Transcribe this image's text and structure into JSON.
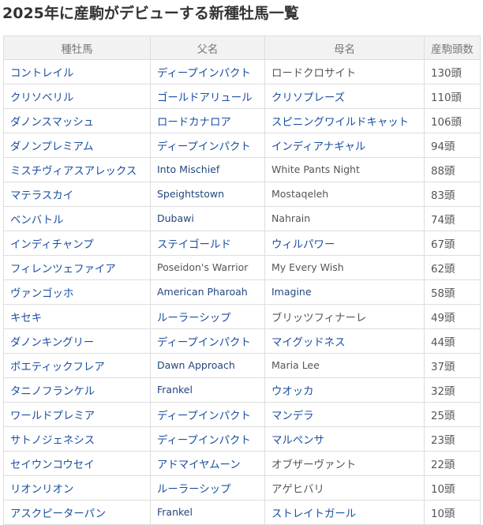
{
  "title": "2025年に産駒がデビューする新種牡馬一覧",
  "table": {
    "headers": [
      "種牡馬",
      "父名",
      "母名",
      "産駒頭数"
    ],
    "rows": [
      {
        "horse": "コントレイル",
        "sire": "ディープインパクト",
        "dam": "ロードクロサイト",
        "count": "130頭",
        "sire_link": true,
        "dam_link": false
      },
      {
        "horse": "クリソベリル",
        "sire": "ゴールドアリュール",
        "dam": "クリソプレーズ",
        "count": "110頭",
        "sire_link": true,
        "dam_link": true
      },
      {
        "horse": "ダノンスマッシュ",
        "sire": "ロードカナロア",
        "dam": "スピニングワイルドキャット",
        "count": "106頭",
        "sire_link": true,
        "dam_link": true
      },
      {
        "horse": "ダノンプレミアム",
        "sire": "ディープインパクト",
        "dam": "インディアナギャル",
        "count": "94頭",
        "sire_link": true,
        "dam_link": true
      },
      {
        "horse": "ミスチヴィアスアレックス",
        "sire": "Into Mischief",
        "dam": "White Pants Night",
        "count": "88頭",
        "sire_link": true,
        "dam_link": false
      },
      {
        "horse": "マテラスカイ",
        "sire": "Speightstown",
        "dam": "Mostaqeleh",
        "count": "83頭",
        "sire_link": true,
        "dam_link": false
      },
      {
        "horse": "ベンバトル",
        "sire": "Dubawi",
        "dam": "Nahrain",
        "count": "74頭",
        "sire_link": true,
        "dam_link": false
      },
      {
        "horse": "インディチャンプ",
        "sire": "ステイゴールド",
        "dam": "ウィルパワー",
        "count": "67頭",
        "sire_link": true,
        "dam_link": true
      },
      {
        "horse": "フィレンツェファイア",
        "sire": "Poseidon's Warrior",
        "dam": "My Every Wish",
        "count": "62頭",
        "sire_link": false,
        "dam_link": false
      },
      {
        "horse": "ヴァンゴッホ",
        "sire": "American Pharoah",
        "dam": "Imagine",
        "count": "58頭",
        "sire_link": true,
        "dam_link": true
      },
      {
        "horse": "キセキ",
        "sire": "ルーラーシップ",
        "dam": "ブリッツフィナーレ",
        "count": "49頭",
        "sire_link": true,
        "dam_link": false
      },
      {
        "horse": "ダノンキングリー",
        "sire": "ディープインパクト",
        "dam": "マイグッドネス",
        "count": "44頭",
        "sire_link": true,
        "dam_link": true
      },
      {
        "horse": "ポエティックフレア",
        "sire": "Dawn Approach",
        "dam": "Maria Lee",
        "count": "37頭",
        "sire_link": true,
        "dam_link": false
      },
      {
        "horse": "タニノフランケル",
        "sire": "Frankel",
        "dam": "ウオッカ",
        "count": "32頭",
        "sire_link": true,
        "dam_link": true
      },
      {
        "horse": "ワールドプレミア",
        "sire": "ディープインパクト",
        "dam": "マンデラ",
        "count": "25頭",
        "sire_link": true,
        "dam_link": true
      },
      {
        "horse": "サトノジェネシス",
        "sire": "ディープインパクト",
        "dam": "マルペンサ",
        "count": "23頭",
        "sire_link": true,
        "dam_link": true
      },
      {
        "horse": "セイウンコウセイ",
        "sire": "アドマイヤムーン",
        "dam": "オブザーヴァント",
        "count": "22頭",
        "sire_link": true,
        "dam_link": false
      },
      {
        "horse": "リオンリオン",
        "sire": "ルーラーシップ",
        "dam": "アゲヒバリ",
        "count": "10頭",
        "sire_link": true,
        "dam_link": false
      },
      {
        "horse": "アスクピーターパン",
        "sire": "Frankel",
        "dam": "ストレイトガール",
        "count": "10頭",
        "sire_link": true,
        "dam_link": true
      }
    ]
  },
  "colors": {
    "link": "#1a4fa0",
    "plain_text": "#555555",
    "header_bg": "#f2f2f2",
    "border": "#dddddd"
  }
}
